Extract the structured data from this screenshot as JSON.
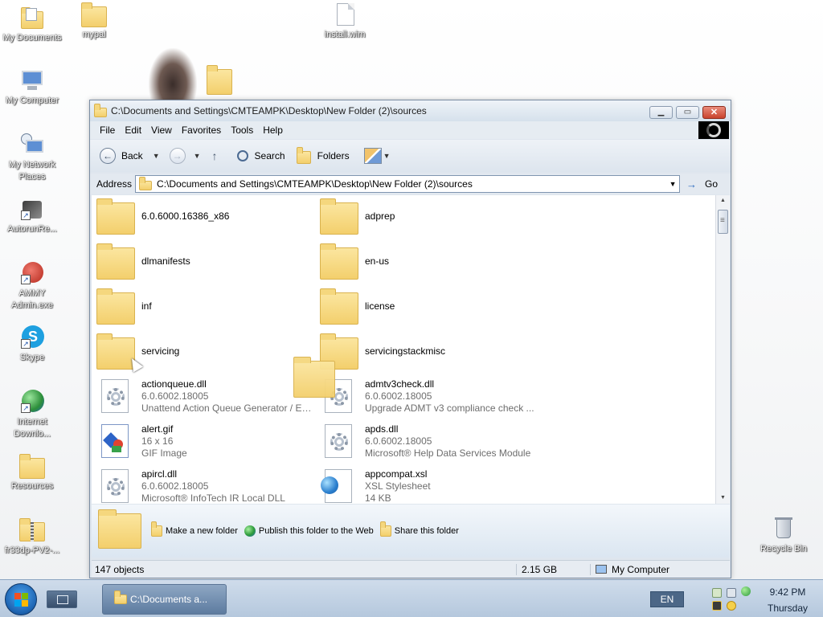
{
  "desktop": {
    "icons": [
      {
        "label": "My Documents",
        "icon": "my-documents-icon"
      },
      {
        "label": "mypal",
        "icon": "folder-icon"
      },
      {
        "label": "install.wim",
        "icon": "file-icon"
      },
      {
        "label": "My Computer",
        "icon": "my-computer-icon"
      },
      {
        "label": "My Network Places",
        "icon": "network-places-icon"
      },
      {
        "label": "AutorunRe...",
        "icon": "autorun-icon"
      },
      {
        "label": "AMMY Admin.exe",
        "icon": "ammy-admin-icon"
      },
      {
        "label": "Skype",
        "icon": "skype-icon"
      },
      {
        "label": "Internet Downlo...",
        "icon": "internet-download-icon"
      },
      {
        "label": "Resources",
        "icon": "folder-icon"
      },
      {
        "label": "fr33dp-PV2-...",
        "icon": "zip-folder-icon"
      },
      {
        "label": "Recycle Bin",
        "icon": "recycle-bin-icon"
      }
    ]
  },
  "window": {
    "title": "C:\\Documents and Settings\\CMTEAMPK\\Desktop\\New Folder (2)\\sources",
    "menu": [
      "File",
      "Edit",
      "View",
      "Favorites",
      "Tools",
      "Help"
    ],
    "toolbar": {
      "back_label": "Back",
      "search_label": "Search",
      "folders_label": "Folders"
    },
    "address": {
      "label": "Address",
      "value": "C:\\Documents and Settings\\CMTEAMPK\\Desktop\\New Folder (2)\\sources",
      "go_label": "Go"
    },
    "items": [
      {
        "type": "folder",
        "name": "6.0.6000.16386_x86"
      },
      {
        "type": "folder",
        "name": "adprep"
      },
      {
        "type": "folder",
        "name": "dlmanifests"
      },
      {
        "type": "folder",
        "name": "en-us"
      },
      {
        "type": "folder",
        "name": "inf"
      },
      {
        "type": "folder",
        "name": "license"
      },
      {
        "type": "folder",
        "name": "servicing"
      },
      {
        "type": "folder",
        "name": "servicingstackmisc"
      },
      {
        "type": "dll",
        "name": "actionqueue.dll",
        "line2": "6.0.6002.18005",
        "line3": "Unattend Action Queue Generator / Ex..."
      },
      {
        "type": "dll",
        "name": "admtv3check.dll",
        "line2": "6.0.6002.18005",
        "line3": "Upgrade ADMT v3 compliance check ..."
      },
      {
        "type": "gif",
        "name": "alert.gif",
        "line2": "16 x 16",
        "line3": "GIF Image"
      },
      {
        "type": "dll",
        "name": "apds.dll",
        "line2": "6.0.6002.18005",
        "line3": "Microsoft® Help Data Services Module"
      },
      {
        "type": "dll",
        "name": "apircl.dll",
        "line2": "6.0.6002.18005",
        "line3": "Microsoft® InfoTech IR Local DLL"
      },
      {
        "type": "xsl",
        "name": "appcompat.xsl",
        "line2": "XSL Stylesheet",
        "line3": "14 KB"
      }
    ],
    "tasks": {
      "make_folder": "Make a new folder",
      "publish": "Publish this folder to the Web",
      "share": "Share this folder"
    },
    "status": {
      "objects": "147 objects",
      "size": "2.15 GB",
      "location": "My Computer"
    }
  },
  "taskbar": {
    "task_label": "C:\\Documents a...",
    "language": "EN",
    "time": "9:42 PM",
    "day": "Thursday"
  },
  "colors": {
    "folder": "#f3cf6c",
    "accent": "#2c6bc0",
    "taskbar": "#b5c8dd"
  }
}
